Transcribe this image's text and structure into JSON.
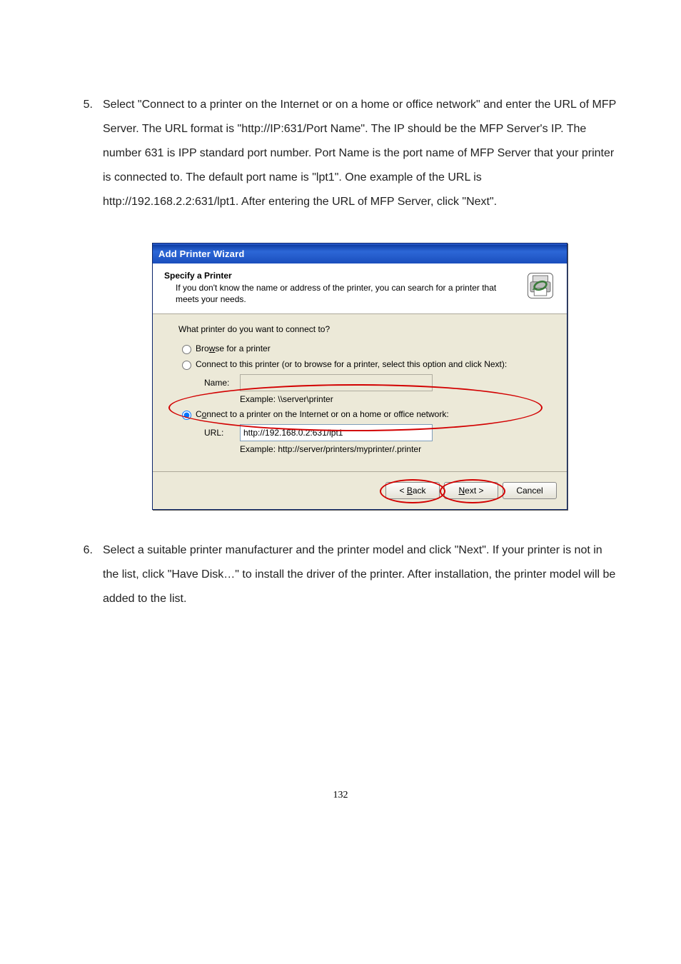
{
  "step5": {
    "number": "5.",
    "text": "Select \"Connect to a printer on the Internet or on a home or office network\" and enter the URL of MFP Server. The URL format is \"http://IP:631/Port Name\". The IP should be the MFP Server's IP. The number 631 is IPP standard port number. Port Name is the port name of MFP Server that your printer is connected to. The default port name is \"lpt1\". One example of the URL is http://192.168.2.2:631/lpt1. After entering the URL of MFP Server, click \"Next\"."
  },
  "dialog": {
    "title": "Add Printer Wizard",
    "header_title": "Specify a Printer",
    "header_sub": "If you don't know the name or address of the printer, you can search for a printer that meets your needs.",
    "question": "What printer do you want to connect to?",
    "opt_browse": "Browse for a printer",
    "opt_connect_name": "Connect to this printer (or to browse for a printer, select this option and click Next):",
    "name_label": "Name:",
    "name_value": "",
    "name_example": "Example: \\\\server\\printer",
    "opt_connect_url": "Connect to a printer on the Internet or on a home or office network:",
    "url_label": "URL:",
    "url_value": "http://192.168.0.2:631/lpt1",
    "url_example": "Example: http://server/printers/myprinter/.printer",
    "btn_back": "< Back",
    "btn_next": "Next >",
    "btn_cancel": "Cancel"
  },
  "step6": {
    "number": "6.",
    "text": "Select a suitable printer manufacturer and the printer model and click \"Next\". If your printer is not in the list, click \"Have Disk…\" to install the driver of the printer. After installation, the printer model will be added to the list."
  },
  "page_number": "132"
}
